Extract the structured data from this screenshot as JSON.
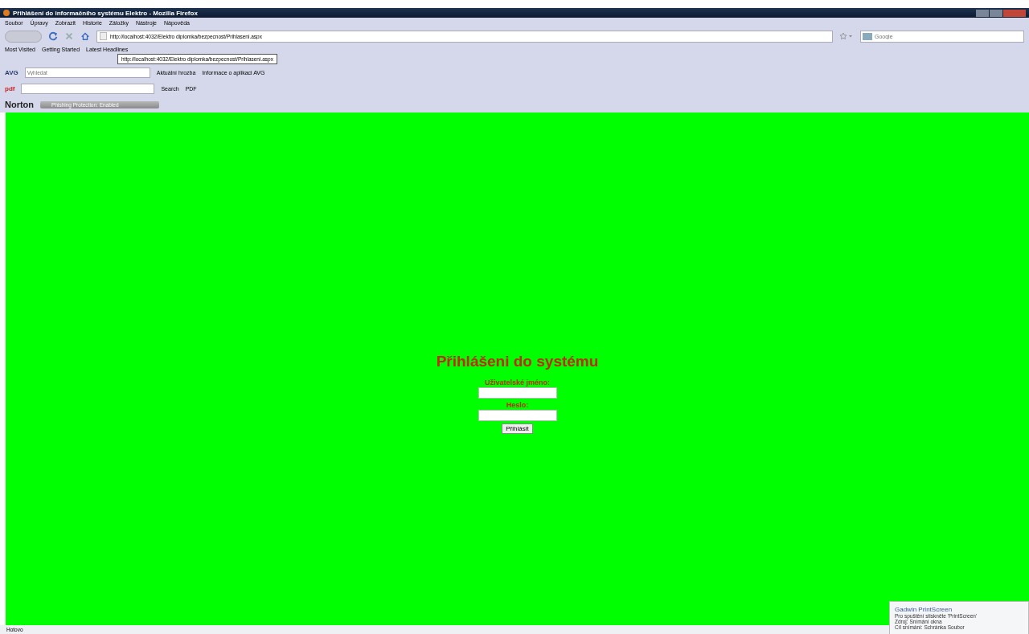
{
  "window": {
    "title": "Přihlášení do informačního systému Elektro - Mozilla Firefox"
  },
  "menu": [
    "Soubor",
    "Úpravy",
    "Zobrazit",
    "Historie",
    "Záložky",
    "Nástroje",
    "Nápověda"
  ],
  "address_bar": {
    "value": "http://localhost:4032/Elektro diplomka/bezpecnost/Prihlaseni.aspx"
  },
  "search_box": {
    "placeholder": "Google"
  },
  "bookmarks": [
    "Most Visited",
    "Getting Started",
    "Latest Headlines"
  ],
  "tooltip": "http://localhost:4032/Elektro diplomka/bezpecnost/Prihlaseni.aspx",
  "avg_toolbar": {
    "logo": "AVG",
    "search_placeholder": "Vyhledat",
    "items": [
      "Aktuální hrozba",
      "Informace o aplikaci AVG"
    ]
  },
  "pdf_toolbar": {
    "logo": "pdf",
    "search": "Search",
    "pdf": "PDF"
  },
  "norton_toolbar": {
    "logo": "Norton",
    "status": "Phishing Protection: Enabled"
  },
  "login": {
    "heading": "Přihlášeni do systému",
    "username_label": "Uživatelské jméno:",
    "password_label": "Heslo:",
    "submit": "Přihlásit"
  },
  "notification": {
    "title": "Gadwin PrintScreen",
    "lines": [
      "Pro spuštění stiskněte 'PrintScreen'",
      "Zdroj: Snímání okna",
      "Cíl snímání: Schránka Soubor"
    ]
  },
  "status_bar": "Hotovo"
}
